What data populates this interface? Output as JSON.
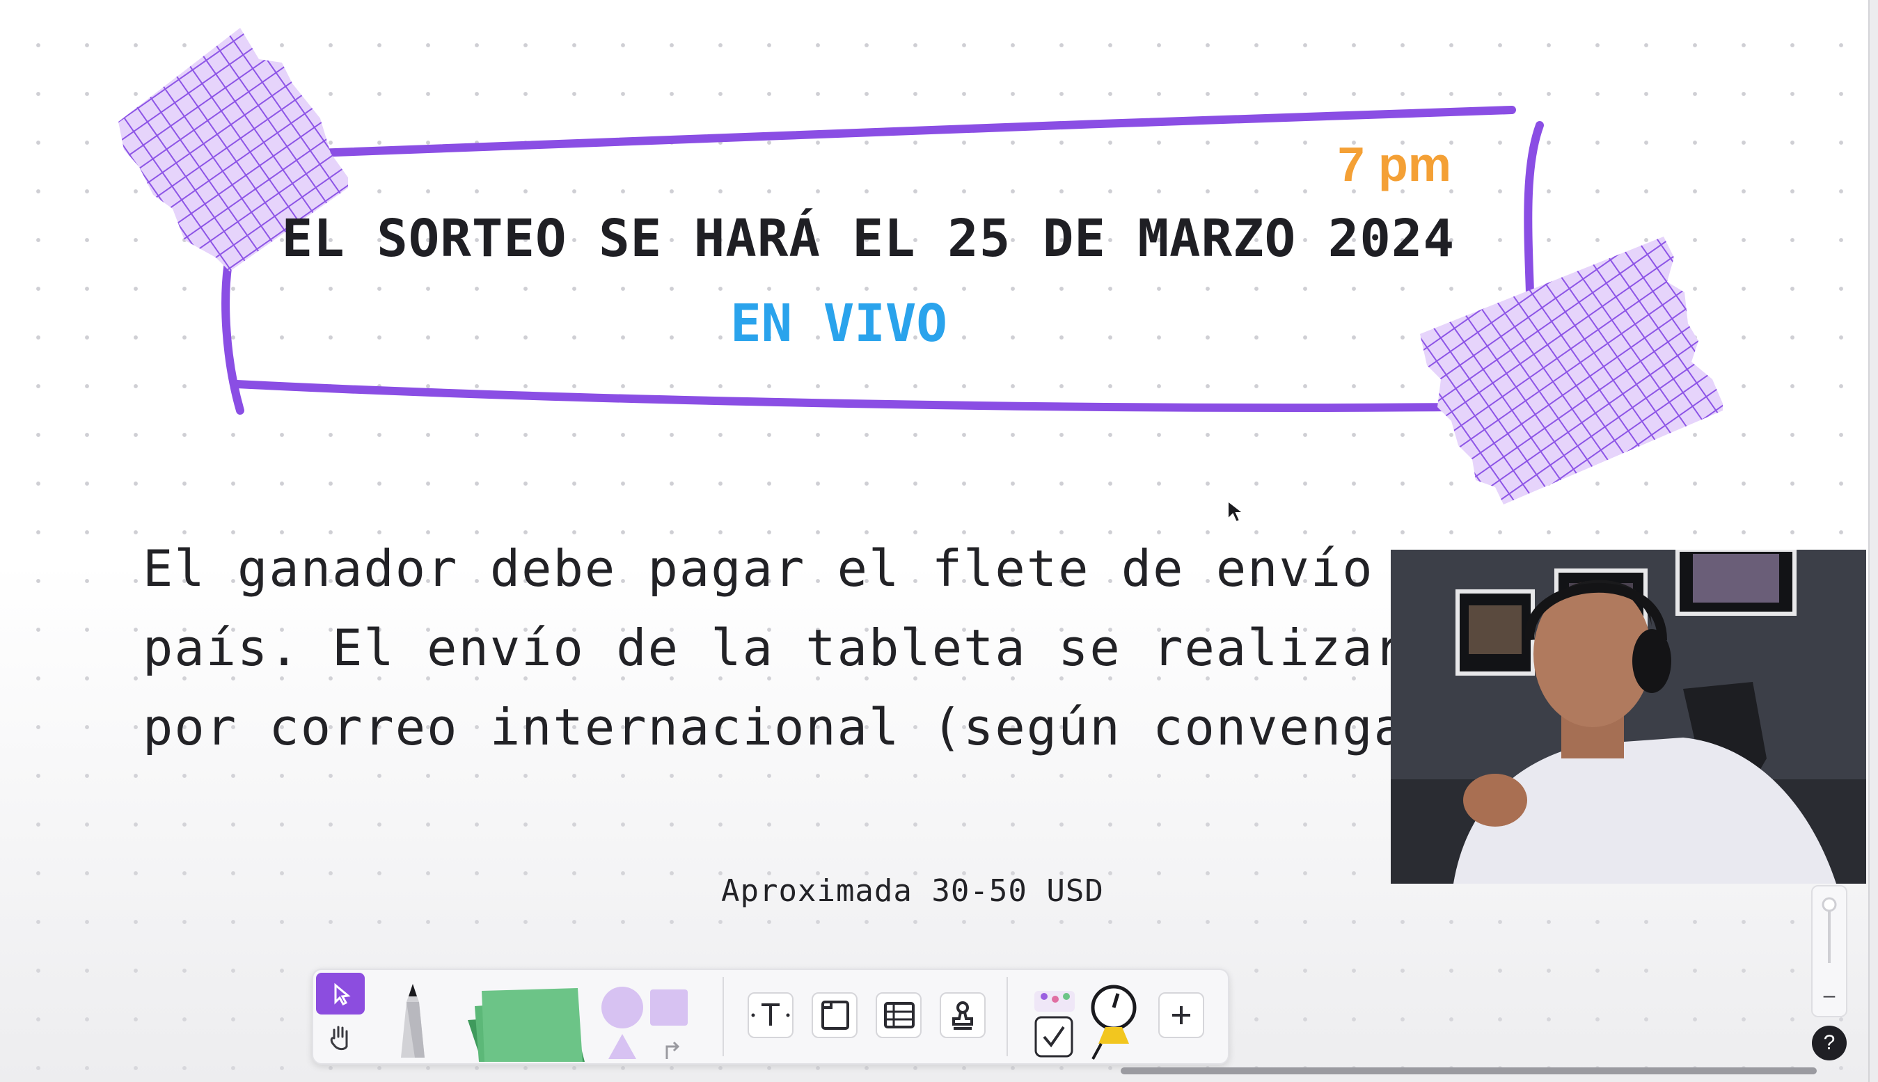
{
  "banner": {
    "time": "7 pm",
    "title": "EL SORTEO SE HARÁ EL 25 DE MARZO 2024",
    "subtitle": "EN VIVO"
  },
  "body_lines": [
    "El ganador debe pagar el flete de envío a",
    "país. El envío de la tableta se realizara",
    "por correo internacional (según convenga"
  ],
  "note": "Aproximada 30-50 USD",
  "toolbar": {
    "tools": [
      "select-tool",
      "hand-tool",
      "pen-tool",
      "sticky-note-tool",
      "shapes-tool",
      "text-tool",
      "frame-tool",
      "table-tool",
      "stamp-tool",
      "widgets-tool",
      "more-tool"
    ]
  },
  "zoom": {
    "minus_label": "–"
  },
  "help_label": "?",
  "colors": {
    "accent_purple": "#8c4ddf",
    "time_orange": "#f4a035",
    "live_blue": "#2aa3ec"
  }
}
